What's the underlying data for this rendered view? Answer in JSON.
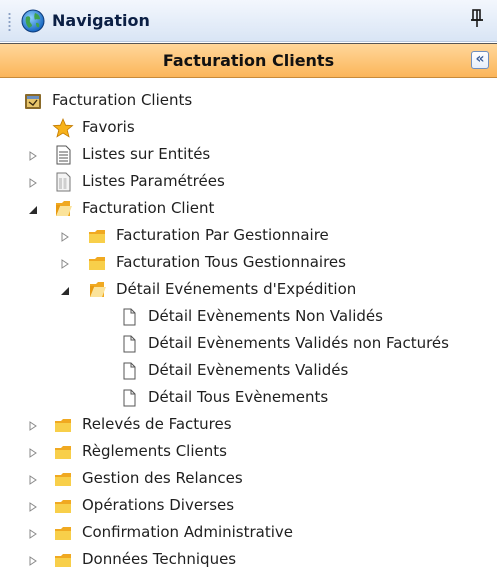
{
  "header": {
    "title": "Navigation",
    "icon": "globe-icon",
    "pin_icon": "pin-icon"
  },
  "section": {
    "title": "Facturation Clients",
    "collapse_icon": "double-chevron-left-icon",
    "collapse_glyph": "«"
  },
  "tree": {
    "items": [
      {
        "label": "Facturation Clients",
        "icon": "module-icon",
        "expander": "none",
        "level": 0
      },
      {
        "label": "Favoris",
        "icon": "star-icon",
        "expander": "none",
        "level": 1
      },
      {
        "label": "Listes sur Entités",
        "icon": "document-list-icon",
        "expander": "collapsed",
        "level": 1
      },
      {
        "label": "Listes Paramétrées",
        "icon": "document-columns-icon",
        "expander": "collapsed",
        "level": 1
      },
      {
        "label": "Facturation Client",
        "icon": "folder-open-icon",
        "expander": "expanded",
        "level": 1
      },
      {
        "label": "Facturation Par Gestionnaire",
        "icon": "folder-icon",
        "expander": "collapsed",
        "level": 2
      },
      {
        "label": "Facturation Tous Gestionnaires",
        "icon": "folder-icon",
        "expander": "collapsed",
        "level": 2
      },
      {
        "label": "Détail Evénements d'Expédition",
        "icon": "folder-open-icon",
        "expander": "expanded",
        "level": 2
      },
      {
        "label": "Détail Evènements Non Validés",
        "icon": "page-icon",
        "expander": "none",
        "level": 3
      },
      {
        "label": "Détail Evènements Validés non Facturés",
        "icon": "page-icon",
        "expander": "none",
        "level": 3
      },
      {
        "label": "Détail Evènements Validés",
        "icon": "page-icon",
        "expander": "none",
        "level": 3
      },
      {
        "label": "Détail Tous Evènements",
        "icon": "page-icon",
        "expander": "none",
        "level": 3
      },
      {
        "label": "Relevés de Factures",
        "icon": "folder-icon",
        "expander": "collapsed",
        "level": 1
      },
      {
        "label": "Règlements Clients",
        "icon": "folder-icon",
        "expander": "collapsed",
        "level": 1
      },
      {
        "label": "Gestion des Relances",
        "icon": "folder-icon",
        "expander": "collapsed",
        "level": 1
      },
      {
        "label": "Opérations Diverses",
        "icon": "folder-icon",
        "expander": "collapsed",
        "level": 1
      },
      {
        "label": "Confirmation Administrative",
        "icon": "folder-icon",
        "expander": "collapsed",
        "level": 1
      },
      {
        "label": "Données Techniques",
        "icon": "folder-icon",
        "expander": "collapsed",
        "level": 1
      }
    ]
  },
  "colors": {
    "header_gradient_top": "#f3f7fd",
    "header_gradient_bottom": "#d9e5f5",
    "section_gradient_top": "#ffd79a",
    "section_gradient_bottom": "#fbb55a",
    "folder": "#f6c342",
    "star": "#f7b21b"
  }
}
